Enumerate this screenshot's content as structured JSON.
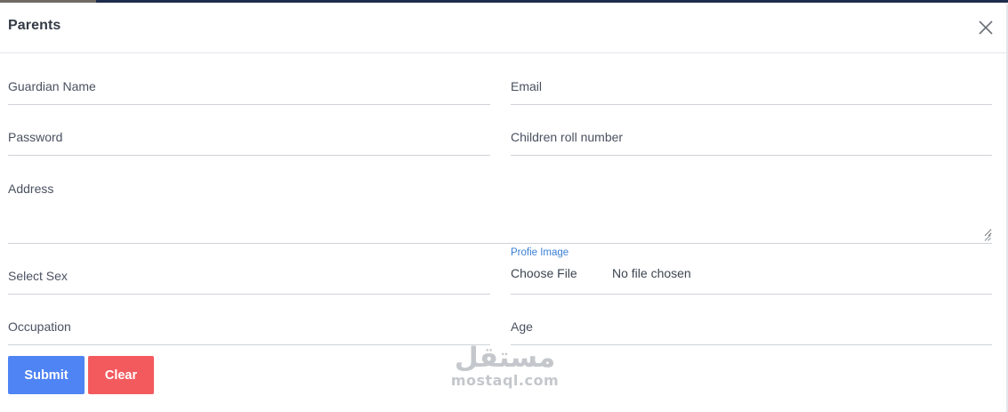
{
  "modal": {
    "title": "Parents",
    "close_icon": "close-icon"
  },
  "form": {
    "guardian_name": {
      "placeholder": "Guardian Name",
      "value": ""
    },
    "email": {
      "placeholder": "Email",
      "value": ""
    },
    "password": {
      "placeholder": "Password",
      "value": ""
    },
    "children_roll_number": {
      "placeholder": "Children roll number",
      "value": ""
    },
    "address": {
      "placeholder": "Address",
      "value": ""
    },
    "select_sex": {
      "placeholder": "Select Sex",
      "value": ""
    },
    "profile_image": {
      "label": "Profie Image",
      "button_label": "Choose File",
      "status": "No file chosen"
    },
    "occupation": {
      "placeholder": "Occupation",
      "value": ""
    },
    "age": {
      "placeholder": "Age",
      "value": ""
    }
  },
  "actions": {
    "submit_label": "Submit",
    "clear_label": "Clear"
  },
  "watermark": {
    "arabic": "مستقل",
    "latin": "mostaql.com"
  },
  "colors": {
    "submit": "#4f84f4",
    "clear": "#f35a5e",
    "file_label": "#3a7fd5"
  }
}
